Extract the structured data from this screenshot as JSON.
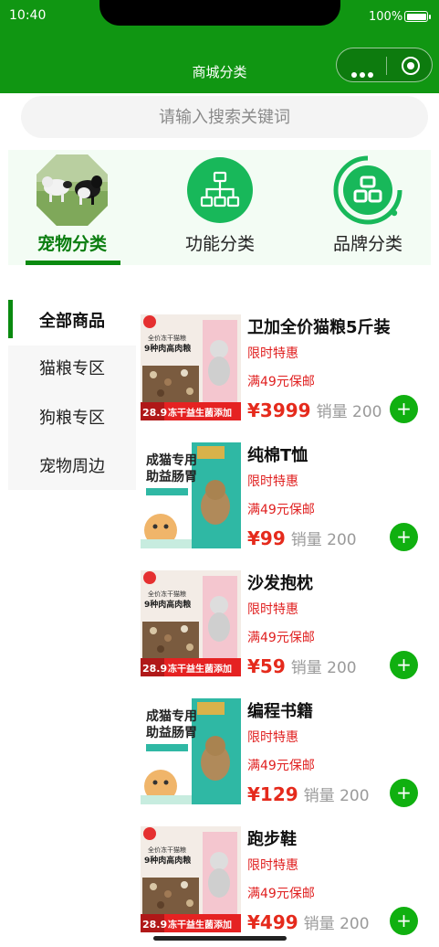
{
  "status_bar": {
    "time": "10:40",
    "battery": "100%"
  },
  "nav": {
    "title": "商城分类"
  },
  "search": {
    "placeholder": "请输入搜索关键词"
  },
  "category_tabs": [
    {
      "label": "宠物分类",
      "icon": "pet-photo",
      "active": true
    },
    {
      "label": "功能分类",
      "icon": "sitemap-icon",
      "active": false
    },
    {
      "label": "品牌分类",
      "icon": "blocks-icon",
      "active": false
    }
  ],
  "sidebar": {
    "items": [
      {
        "label": "全部商品",
        "active": true
      },
      {
        "label": "猫粮专区",
        "active": false
      },
      {
        "label": "狗粮专区",
        "active": false
      },
      {
        "label": "宠物周边",
        "active": false
      }
    ]
  },
  "products": [
    {
      "name": "卫加全价猫粮5斤装",
      "tag1": "限时特惠",
      "tag2": "满49元保邮",
      "price": "¥3999",
      "sales": "销量 200",
      "image": "cat-food-bag",
      "add": "+"
    },
    {
      "name": "纯棉T恤",
      "tag1": "限时特惠",
      "tag2": "满49元保邮",
      "price": "¥99",
      "sales": "销量 200",
      "image": "probiotic-bag",
      "add": "+"
    },
    {
      "name": "沙发抱枕",
      "tag1": "限时特惠",
      "tag2": "满49元保邮",
      "price": "¥59",
      "sales": "销量 200",
      "image": "cat-food-bag",
      "add": "+"
    },
    {
      "name": "编程书籍",
      "tag1": "限时特惠",
      "tag2": "满49元保邮",
      "price": "¥129",
      "sales": "销量 200",
      "image": "probiotic-bag",
      "add": "+"
    },
    {
      "name": "跑步鞋",
      "tag1": "限时特惠",
      "tag2": "满49元保邮",
      "price": "¥499",
      "sales": "销量 200",
      "image": "cat-food-bag",
      "add": "+"
    }
  ],
  "product_images": {
    "cat_food": {
      "badge": "28.9",
      "line1": "全价冻干猫粮",
      "line2": "9种肉高肉粮",
      "line3": "冻干益生菌添加"
    },
    "probiotic": {
      "line1": "成猫专用",
      "line2": "助益肠胃"
    }
  },
  "colors": {
    "brand_green": "#109612",
    "accent_green": "#0a8a10",
    "price_red": "#e52a1c",
    "tag_red": "#e02020"
  }
}
